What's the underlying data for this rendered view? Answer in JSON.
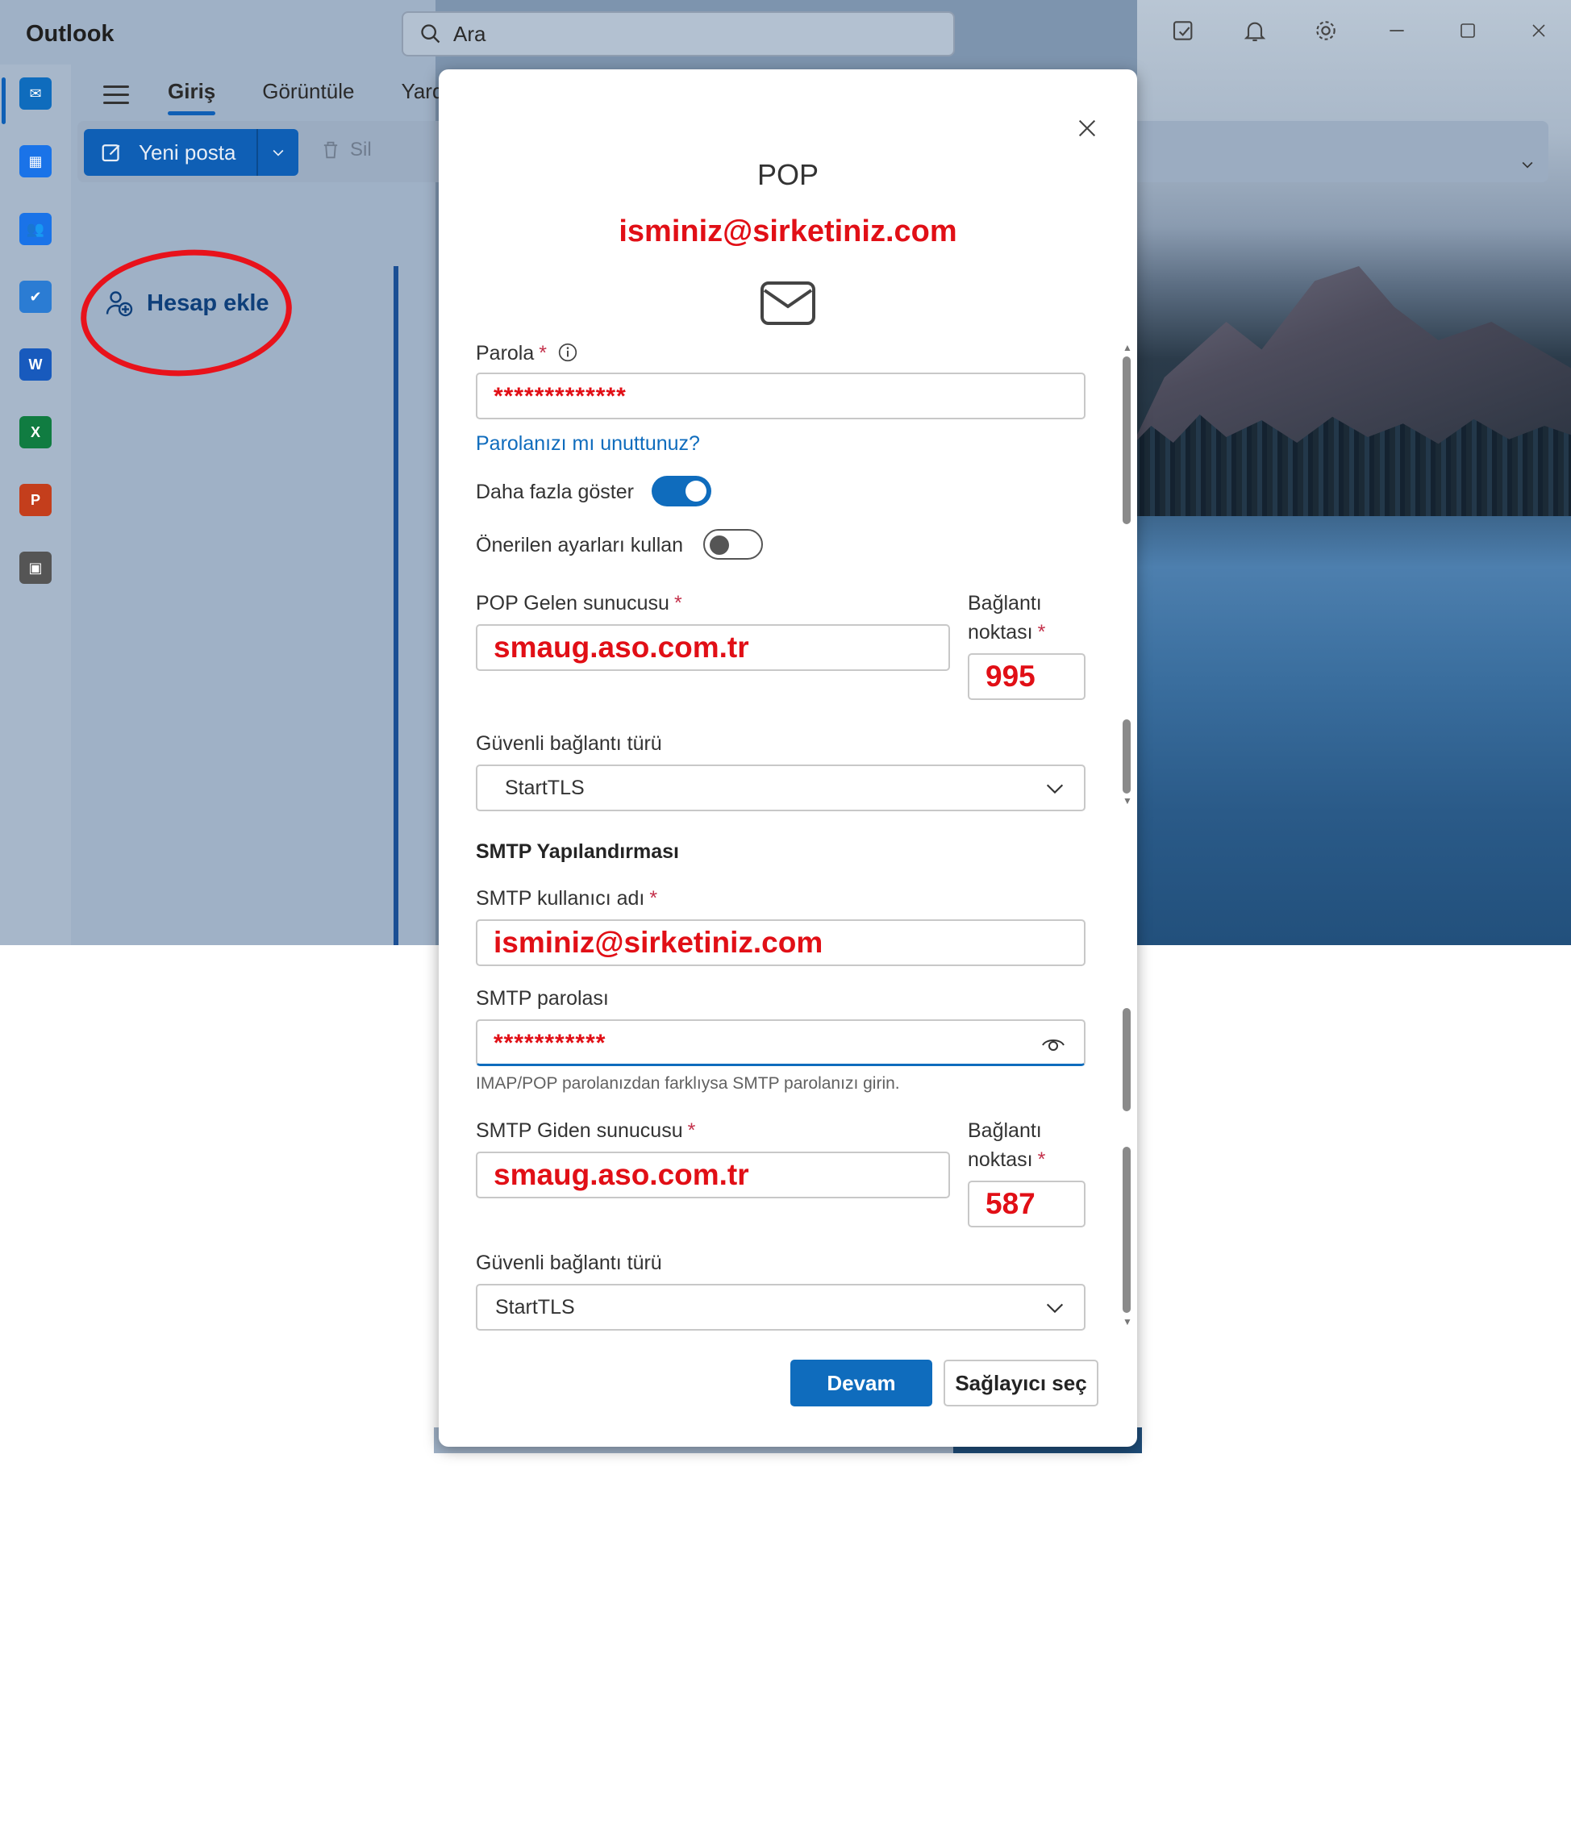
{
  "app": {
    "title": "Outlook",
    "search_placeholder": "Ara",
    "ribbon_tabs": [
      "Giriş",
      "Görüntüle",
      "Yardı"
    ],
    "new_mail_label": "Yeni posta",
    "delete_label": "Sil",
    "add_account_label": "Hesap ekle",
    "rail_items": [
      {
        "name": "mail-icon",
        "glyph": "✉",
        "color": "#0f6cbd"
      },
      {
        "name": "calendar-icon",
        "glyph": "▦",
        "color": "#1a73e8"
      },
      {
        "name": "people-icon",
        "glyph": "👥",
        "color": "#1a73e8"
      },
      {
        "name": "todo-icon",
        "glyph": "✔",
        "color": "#2b7cd3"
      },
      {
        "name": "word-icon",
        "glyph": "W",
        "color": "#185abd"
      },
      {
        "name": "excel-icon",
        "glyph": "X",
        "color": "#107c41"
      },
      {
        "name": "powerpoint-icon",
        "glyph": "P",
        "color": "#c43e1c"
      },
      {
        "name": "apps-icon",
        "glyph": "▣",
        "color": "#555555"
      }
    ]
  },
  "dialog": {
    "title": "POP",
    "account_email": "isminiz@sirketiniz.com",
    "password_label": "Parola",
    "password_value": "*************",
    "forgot_password_link": "Parolanızı mı unuttunuz?",
    "show_more_label": "Daha fazla göster",
    "show_more_on": true,
    "recommended_label": "Önerilen ayarları kullan",
    "recommended_on": false,
    "pop_server_label": "POP Gelen sunucusu",
    "pop_server_value": "smaug.aso.com.tr",
    "pop_port_label_1": "Bağlantı",
    "pop_port_label_2": "noktası",
    "pop_port_value": "995",
    "pop_secure_label": "Güvenli bağlantı türü",
    "pop_secure_value": "StartTLS",
    "smtp_section": "SMTP Yapılandırması",
    "smtp_user_label": "SMTP kullanıcı adı",
    "smtp_user_value": "isminiz@sirketiniz.com",
    "smtp_password_label": "SMTP parolası",
    "smtp_password_value": "***********",
    "smtp_password_hint": "IMAP/POP parolanızdan farklıysa SMTP parolanızı girin.",
    "smtp_server_label": "SMTP Giden sunucusu",
    "smtp_server_value": "smaug.aso.com.tr",
    "smtp_port_label_1": "Bağlantı",
    "smtp_port_label_2": "noktası",
    "smtp_port_value": "587",
    "smtp_secure_label": "Güvenli bağlantı türü",
    "smtp_secure_value": "StartTLS",
    "continue_button": "Devam",
    "choose_provider_button": "Sağlayıcı seç",
    "required_mark": "*"
  }
}
